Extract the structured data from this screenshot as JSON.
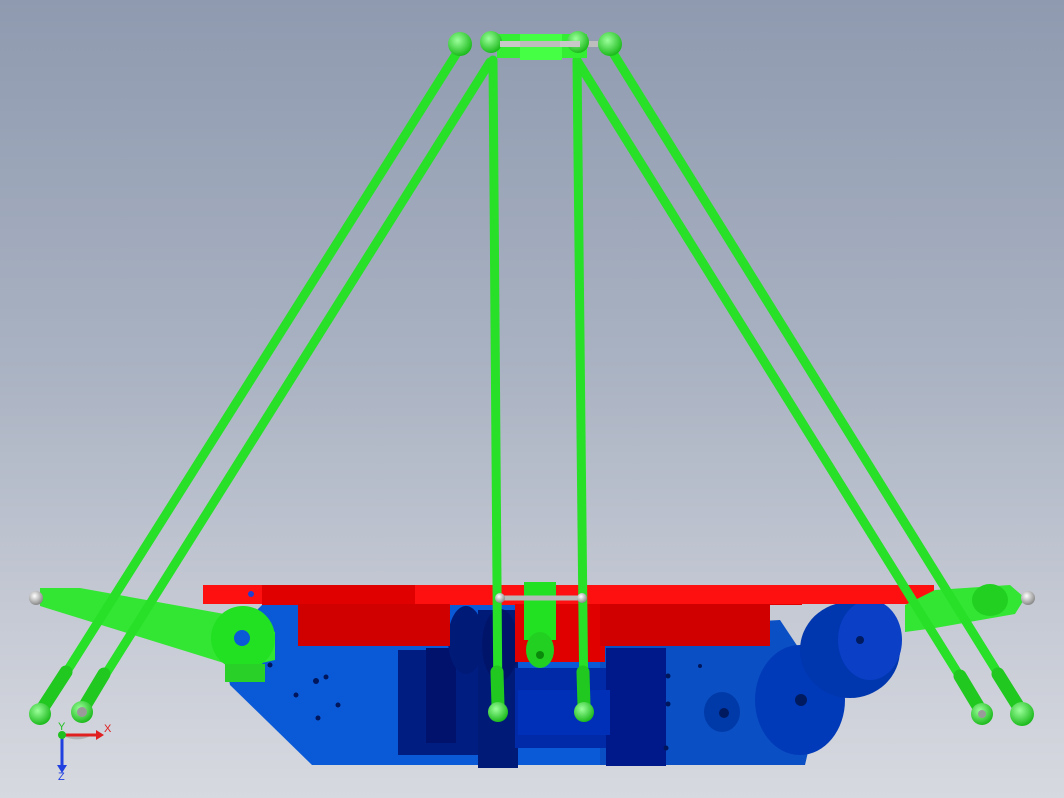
{
  "triad": {
    "x_label": "X",
    "y_label": "Y",
    "z_label": "Z",
    "x_color": "#e02020",
    "y_color": "#20c020",
    "z_color": "#2040e0"
  },
  "colors": {
    "link_green": "#22ee22",
    "plate_red": "#ff0000",
    "body_blue": "#0a5ad8",
    "dark_blue": "#001f8a",
    "pin_gray": "#b0b0b0"
  }
}
